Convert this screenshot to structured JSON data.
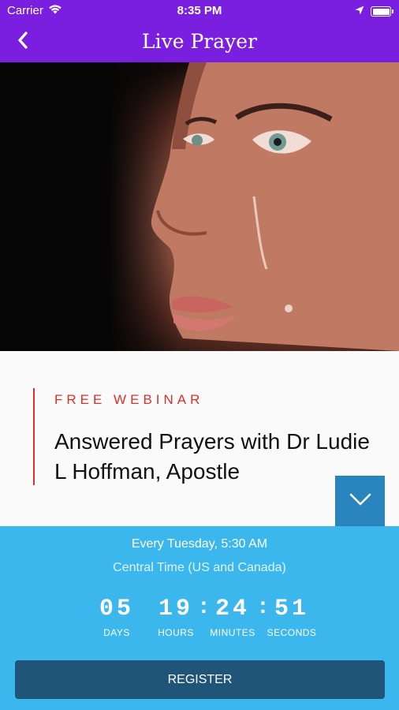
{
  "status_bar": {
    "carrier": "Carrier",
    "time": "8:35 PM"
  },
  "nav": {
    "title": "Live Prayer"
  },
  "webinar": {
    "kicker": "FREE WEBINAR",
    "title": "Answered Prayers with Dr Ludie L Hoffman, Apostle"
  },
  "countdown": {
    "schedule": "Every Tuesday, 5:30 AM",
    "timezone": "Central Time (US and Canada)",
    "days": {
      "value": "05",
      "label": "DAYS"
    },
    "hours": {
      "value": "19",
      "label": "HOURS"
    },
    "minutes": {
      "value": "24",
      "label": "MINUTES"
    },
    "seconds": {
      "value": "51",
      "label": "SECONDS"
    },
    "register_label": "REGISTER"
  },
  "colors": {
    "nav_background": "#7a1fe0",
    "accent_red": "#d8322d",
    "countdown_background": "#2fb2ed",
    "button_dark_blue": "#205579",
    "collapse_button": "#2a84bd"
  },
  "icons": {
    "back": "chevron-left-icon",
    "wifi": "wifi-icon",
    "location": "location-arrow-icon",
    "battery": "battery-icon",
    "collapse": "chevron-down-icon"
  }
}
